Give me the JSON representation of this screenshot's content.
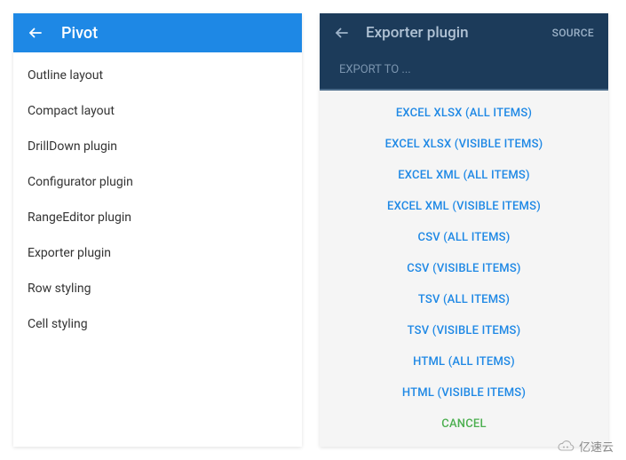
{
  "left": {
    "title": "Pivot",
    "items": [
      "Outline layout",
      "Compact layout",
      "DrillDown plugin",
      "Configurator plugin",
      "RangeEditor plugin",
      "Exporter plugin",
      "Row styling",
      "Cell styling"
    ]
  },
  "right": {
    "title": "Exporter plugin",
    "source_label": "SOURCE",
    "export_to": "EXPORT TO ...",
    "options": [
      "EXCEL XLSX (ALL ITEMS)",
      "EXCEL XLSX (VISIBLE ITEMS)",
      "EXCEL XML (ALL ITEMS)",
      "EXCEL XML (VISIBLE ITEMS)",
      "CSV (ALL ITEMS)",
      "CSV (VISIBLE ITEMS)",
      "TSV (ALL ITEMS)",
      "TSV (VISIBLE ITEMS)",
      "HTML (ALL ITEMS)",
      "HTML (VISIBLE ITEMS)"
    ],
    "cancel": "CANCEL"
  },
  "watermark": "亿速云"
}
